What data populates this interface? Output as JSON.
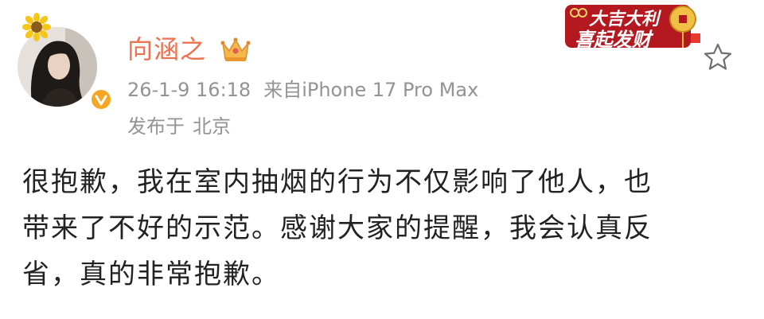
{
  "user": {
    "name": "向涵之",
    "avatar_icon": "avatar-photo",
    "verified_icon": "verified-badge-icon",
    "crown_icon": "crown-icon",
    "flower_icon": "sunflower-icon"
  },
  "meta": {
    "time": "26-1-9 16:18",
    "source": "来自iPhone 17 Pro Max",
    "location_prefix": "发布于",
    "location": "北京"
  },
  "decoration": {
    "line1": "大吉大利",
    "line2": "喜起发财"
  },
  "actions": {
    "favorite_icon": "star-icon"
  },
  "content": {
    "lines": [
      "很抱歉，我在室内抽烟的行为不仅影响了他人，也",
      "带来了不好的示范。感谢大家的提醒，我会认真反",
      "省，真的非常抱歉。"
    ]
  },
  "colors": {
    "username": "#eb7350",
    "meta": "#939393",
    "text": "#222222",
    "deco_red": "#b3191f",
    "verify_orange": "#f5a623"
  }
}
